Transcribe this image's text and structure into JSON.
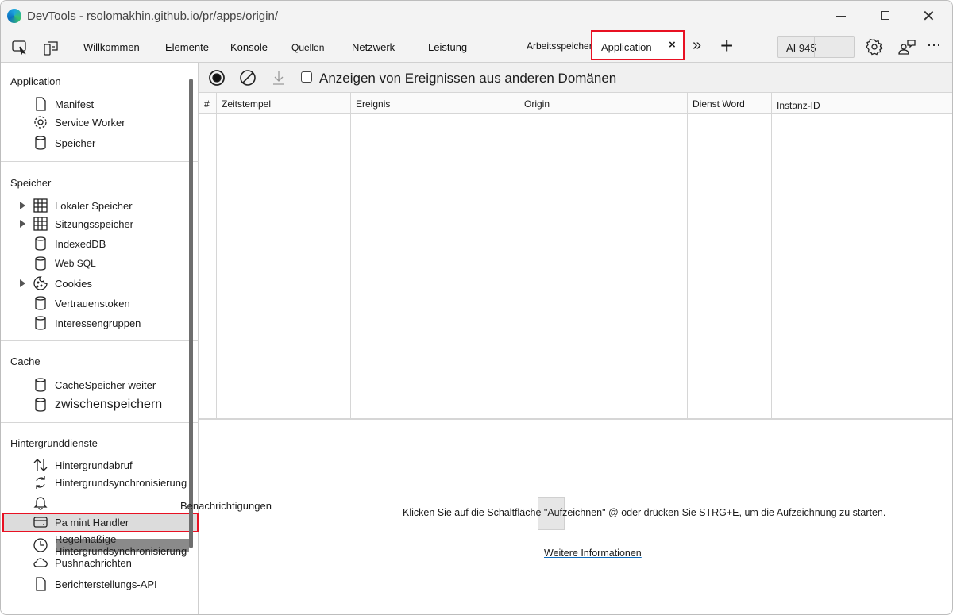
{
  "window": {
    "title": "DevTools - rsolomakhin.github.io/pr/apps/origin/"
  },
  "tabs": [
    {
      "label": "Willkommen"
    },
    {
      "label": "Elemente"
    },
    {
      "label": "Konsole"
    },
    {
      "label": "Quellen"
    },
    {
      "label": "Netzwerk"
    },
    {
      "label": "Leistung"
    },
    {
      "label": "Arbeitsspeicher"
    },
    {
      "label": "Application",
      "active": true
    }
  ],
  "toolbar": {
    "issues_label": "AI 945"
  },
  "sidebar": {
    "sections": [
      {
        "title": "Application",
        "items": [
          "Manifest",
          "Service Worker",
          "Speicher"
        ]
      },
      {
        "title": "Speicher",
        "items": [
          "Lokaler Speicher",
          "Sitzungsspeicher",
          "IndexedDB",
          "Web SQL",
          "Cookies",
          "Vertrauenstoken",
          "Interessengruppen"
        ]
      },
      {
        "title": "Cache",
        "items": [
          "CacheSpeicher weiter",
          "zwischenspeichern"
        ]
      },
      {
        "title": "Hintergrunddienste",
        "items": [
          "Hintergrundabruf",
          "Hintergrundsynchronisierung",
          "Benachrichtigungen",
          "Pa mint Handler",
          "Regelmäßige Hintergrundsynchronisierung",
          "Pushnachrichten",
          "Berichterstellungs-API"
        ]
      }
    ],
    "selected": "Pa mint Handler"
  },
  "main": {
    "checkbox_label": "Anzeigen von Ereignissen aus anderen Domänen",
    "checkbox_checked": false,
    "columns": [
      "#",
      "Zeitstempel",
      "Ereignis",
      "Origin",
      "Dienst Word",
      "Instanz-ID"
    ],
    "message": "Klicken Sie auf die Schaltfläche \"Aufzeichnen\" @ oder drücken Sie STRG+E, um die Aufzeichnung zu starten.",
    "link": "Weitere Informationen"
  },
  "colors": {
    "highlight": "#e81123",
    "link": "#0f6cbd",
    "selected_bg": "#dcdcdc"
  }
}
